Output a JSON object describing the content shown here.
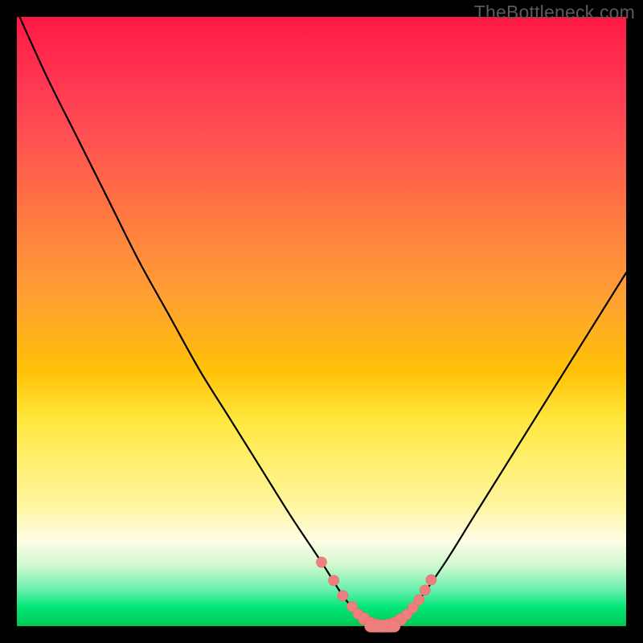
{
  "watermark": "TheBottleneck.com",
  "colors": {
    "frame": "#000000",
    "curve": "#000000",
    "marker": "#ef7e7e",
    "gradient_top": "#ff1744",
    "gradient_bottom": "#00c853"
  },
  "chart_data": {
    "type": "line",
    "title": "",
    "xlabel": "",
    "ylabel": "",
    "xlim": [
      0,
      100
    ],
    "ylim": [
      0,
      100
    ],
    "grid": false,
    "legend": false,
    "series": [
      {
        "name": "bottleneck-curve",
        "x": [
          0,
          5,
          10,
          15,
          20,
          25,
          30,
          35,
          40,
          45,
          50,
          53.5,
          56,
          58,
          60,
          62,
          65,
          70,
          75,
          80,
          85,
          90,
          95,
          100
        ],
        "y": [
          101,
          90,
          80,
          70,
          60,
          51,
          42,
          34,
          26,
          18,
          10.5,
          5,
          2,
          0.5,
          0,
          0.5,
          3,
          10,
          18,
          26,
          34,
          42,
          50,
          58
        ]
      }
    ],
    "markers": {
      "name": "highlight-points",
      "x": [
        50,
        52,
        53.5,
        55,
        56,
        57,
        58,
        59,
        60,
        61,
        62,
        63,
        64,
        65,
        66,
        67,
        68
      ],
      "y": [
        10.5,
        7.5,
        5,
        3.2,
        2,
        1.2,
        0.5,
        0.2,
        0,
        0.2,
        0.5,
        1.1,
        1.9,
        3,
        4.3,
        5.9,
        7.6
      ]
    }
  }
}
